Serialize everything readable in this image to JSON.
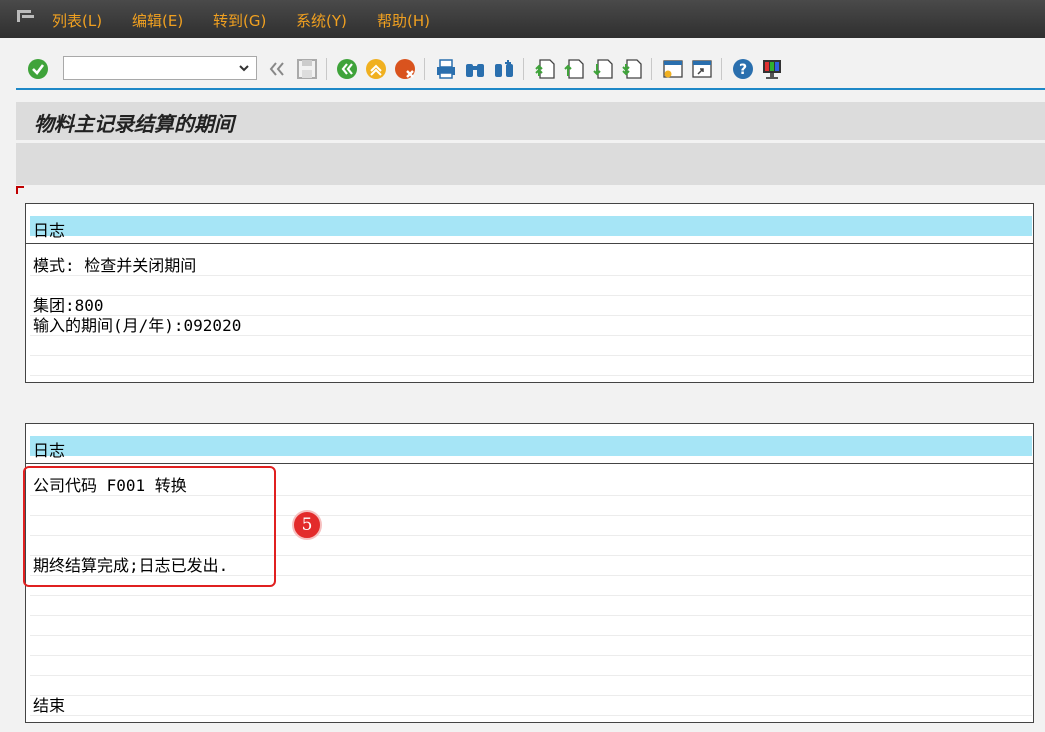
{
  "menubar": {
    "items": [
      {
        "label": "列表(L)"
      },
      {
        "label": "编辑(E)"
      },
      {
        "label": "转到(G)"
      },
      {
        "label": "系统(Y)"
      },
      {
        "label": "帮助(H)"
      }
    ]
  },
  "toolbar": {
    "command_field_value": "",
    "icons": [
      "enter-icon",
      "back-double-icon",
      "save-icon",
      "back-icon",
      "exit-icon",
      "cancel-icon",
      "print-icon",
      "find-icon",
      "find-next-icon",
      "first-page-icon",
      "previous-page-icon",
      "next-page-icon",
      "last-page-icon",
      "create-session-icon",
      "shortcut-icon",
      "help-icon",
      "customize-layout-icon"
    ]
  },
  "title": "物料主记录结算的期间",
  "log1": {
    "header": "日志",
    "rows": [
      "模式: 检查并关闭期间",
      "",
      "集团:800",
      "输入的期间(月/年):092020",
      "",
      ""
    ]
  },
  "log2": {
    "header": "日志",
    "rows": [
      "公司代码 F001 转换",
      "",
      "",
      "期终结算完成;日志已发出.",
      "",
      "",
      "",
      "",
      "",
      "",
      "",
      "结束"
    ]
  },
  "annotation": {
    "badge": "5"
  },
  "colors": {
    "menubar_bg": "#3a3a3a",
    "menu_text": "#f0a020",
    "log_header_bg": "#a6e5f6",
    "accent_line": "#1e88c7",
    "highlight": "#e02020"
  }
}
